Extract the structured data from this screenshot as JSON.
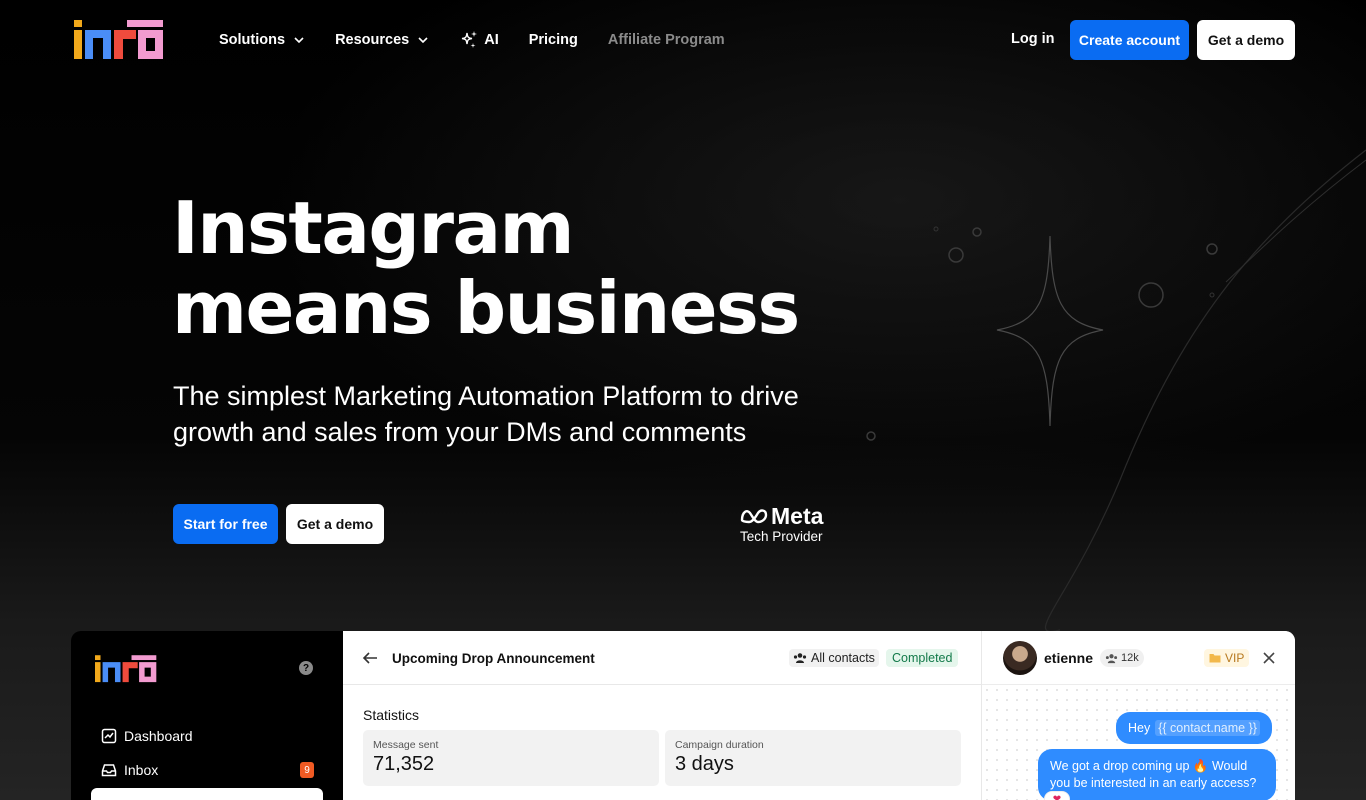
{
  "nav": {
    "items": [
      {
        "label": "Solutions"
      },
      {
        "label": "Resources"
      },
      {
        "label": "AI"
      },
      {
        "label": "Pricing"
      },
      {
        "label": "Affiliate Program"
      }
    ],
    "login": "Log in",
    "create_account": "Create account",
    "get_demo": "Get a demo"
  },
  "hero": {
    "title": "Instagram\nmeans business",
    "subtitle": "The simplest Marketing Automation Platform to drive growth and sales from your DMs and comments",
    "start_free": "Start for free",
    "get_demo": "Get a demo",
    "meta_word": "Meta",
    "meta_sub": "Tech Provider"
  },
  "app": {
    "sidebar": {
      "help": "?",
      "items": [
        {
          "label": "Dashboard",
          "icon": "chart-icon"
        },
        {
          "label": "Inbox",
          "icon": "inbox-icon",
          "badge": "9"
        }
      ]
    },
    "campaign": {
      "title": "Upcoming Drop Announcement",
      "audience": "All contacts",
      "status": "Completed",
      "stats_label": "Statistics",
      "stats": [
        {
          "label": "Message sent",
          "value": "71,352"
        },
        {
          "label": "Campaign duration",
          "value": "3 days"
        }
      ]
    },
    "chat": {
      "name": "etienne",
      "followers": "12k",
      "tag": "VIP",
      "greeting": "Hey",
      "variable": "{{ contact.name }}",
      "message": "We got a drop coming up 🔥 Would you be interested in an early access?",
      "reaction": "❤"
    }
  },
  "colors": {
    "accent": "#0a6cf2",
    "badge": "#f05a23",
    "bubble": "#2f8cff",
    "status_green": "#137a4a"
  }
}
